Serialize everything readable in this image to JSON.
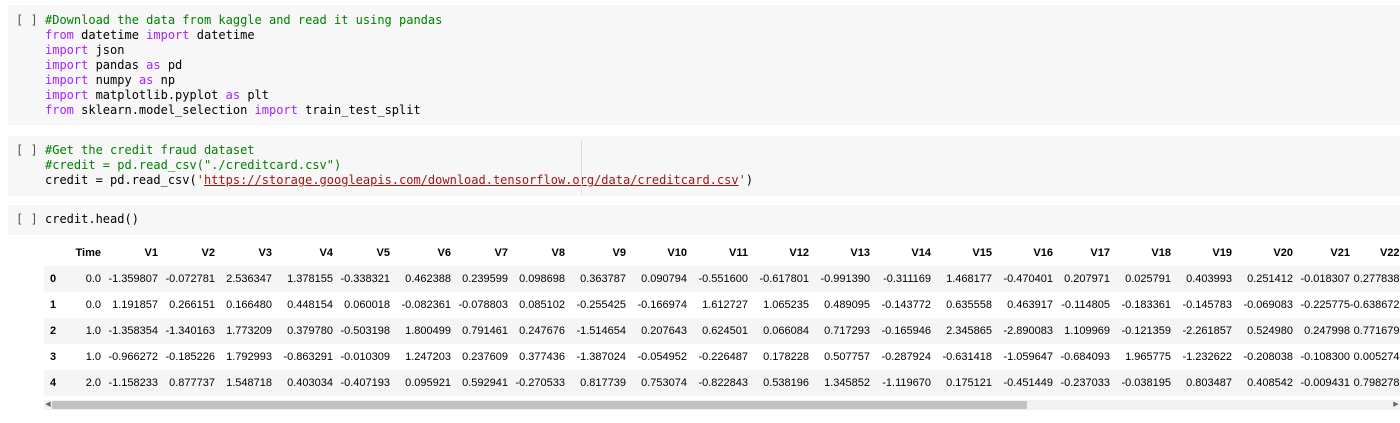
{
  "cells": [
    {
      "run_label": "[ ]",
      "lines": [
        [
          {
            "t": "cm",
            "v": "#Download the data from kaggle and read it using pandas"
          }
        ],
        [
          {
            "t": "kw",
            "v": "from"
          },
          {
            "t": "n",
            "v": " datetime "
          },
          {
            "t": "kw",
            "v": "import"
          },
          {
            "t": "n",
            "v": " datetime"
          }
        ],
        [
          {
            "t": "kw",
            "v": "import"
          },
          {
            "t": "n",
            "v": " json"
          }
        ],
        [
          {
            "t": "kw",
            "v": "import"
          },
          {
            "t": "n",
            "v": " pandas "
          },
          {
            "t": "kw",
            "v": "as"
          },
          {
            "t": "n",
            "v": " pd"
          }
        ],
        [
          {
            "t": "kw",
            "v": "import"
          },
          {
            "t": "n",
            "v": " numpy "
          },
          {
            "t": "kw",
            "v": "as"
          },
          {
            "t": "n",
            "v": " np"
          }
        ],
        [
          {
            "t": "kw",
            "v": "import"
          },
          {
            "t": "n",
            "v": " matplotlib.pyplot "
          },
          {
            "t": "kw",
            "v": "as"
          },
          {
            "t": "n",
            "v": " plt"
          }
        ],
        [
          {
            "t": "kw",
            "v": "from"
          },
          {
            "t": "n",
            "v": " sklearn.model_selection "
          },
          {
            "t": "kw",
            "v": "import"
          },
          {
            "t": "n",
            "v": " train_test_split"
          }
        ]
      ]
    },
    {
      "run_label": "[ ]",
      "lines": [
        [
          {
            "t": "cm",
            "v": "#Get the credit fraud dataset"
          }
        ],
        [
          {
            "t": "cm",
            "v": "#credit = pd.read_csv(\"./creditcard.csv\")"
          }
        ],
        [
          {
            "t": "n",
            "v": "credit = pd.read_csv("
          },
          {
            "t": "st",
            "v": "'"
          },
          {
            "t": "url",
            "v": "https://storage.googleapis.com/download.tensorflow.org/data/creditcard.csv"
          },
          {
            "t": "st",
            "v": "'"
          },
          {
            "t": "n",
            "v": ")"
          }
        ]
      ]
    },
    {
      "run_label": "[ ]",
      "lines": [
        [
          {
            "t": "n",
            "v": "credit.head()"
          }
        ]
      ]
    }
  ],
  "dataframe": {
    "columns": [
      "",
      "Time",
      "V1",
      "V2",
      "V3",
      "V4",
      "V5",
      "V6",
      "V7",
      "V8",
      "V9",
      "V10",
      "V11",
      "V12",
      "V13",
      "V14",
      "V15",
      "V16",
      "V17",
      "V18",
      "V19",
      "V20",
      "V21",
      "V22"
    ],
    "rows": [
      [
        "0",
        "0.0",
        "-1.359807",
        "-0.072781",
        "2.536347",
        "1.378155",
        "-0.338321",
        "0.462388",
        "0.239599",
        "0.098698",
        "0.363787",
        "0.090794",
        "-0.551600",
        "-0.617801",
        "-0.991390",
        "-0.311169",
        "1.468177",
        "-0.470401",
        "0.207971",
        "0.025791",
        "0.403993",
        "0.251412",
        "-0.018307",
        "0.277838"
      ],
      [
        "1",
        "0.0",
        "1.191857",
        "0.266151",
        "0.166480",
        "0.448154",
        "0.060018",
        "-0.082361",
        "-0.078803",
        "0.085102",
        "-0.255425",
        "-0.166974",
        "1.612727",
        "1.065235",
        "0.489095",
        "-0.143772",
        "0.635558",
        "0.463917",
        "-0.114805",
        "-0.183361",
        "-0.145783",
        "-0.069083",
        "-0.225775",
        "-0.638672"
      ],
      [
        "2",
        "1.0",
        "-1.358354",
        "-1.340163",
        "1.773209",
        "0.379780",
        "-0.503198",
        "1.800499",
        "0.791461",
        "0.247676",
        "-1.514654",
        "0.207643",
        "0.624501",
        "0.066084",
        "0.717293",
        "-0.165946",
        "2.345865",
        "-2.890083",
        "1.109969",
        "-0.121359",
        "-2.261857",
        "0.524980",
        "0.247998",
        "0.771679"
      ],
      [
        "3",
        "1.0",
        "-0.966272",
        "-0.185226",
        "1.792993",
        "-0.863291",
        "-0.010309",
        "1.247203",
        "0.237609",
        "0.377436",
        "-1.387024",
        "-0.054952",
        "-0.226487",
        "0.178228",
        "0.507757",
        "-0.287924",
        "-0.631418",
        "-1.059647",
        "-0.684093",
        "1.965775",
        "-1.232622",
        "-0.208038",
        "-0.108300",
        "0.005274"
      ],
      [
        "4",
        "2.0",
        "-1.158233",
        "0.877737",
        "1.548718",
        "0.403034",
        "-0.407193",
        "0.095921",
        "0.592941",
        "-0.270533",
        "0.817739",
        "0.753074",
        "-0.822843",
        "0.538196",
        "1.345852",
        "-1.119670",
        "0.175121",
        "-0.451449",
        "-0.237033",
        "-0.038195",
        "0.803487",
        "0.408542",
        "-0.009431",
        "0.798278"
      ]
    ]
  },
  "scrollbar": {
    "left_arrow": "◀",
    "right_arrow": "▶",
    "position_fraction": 0.72
  }
}
